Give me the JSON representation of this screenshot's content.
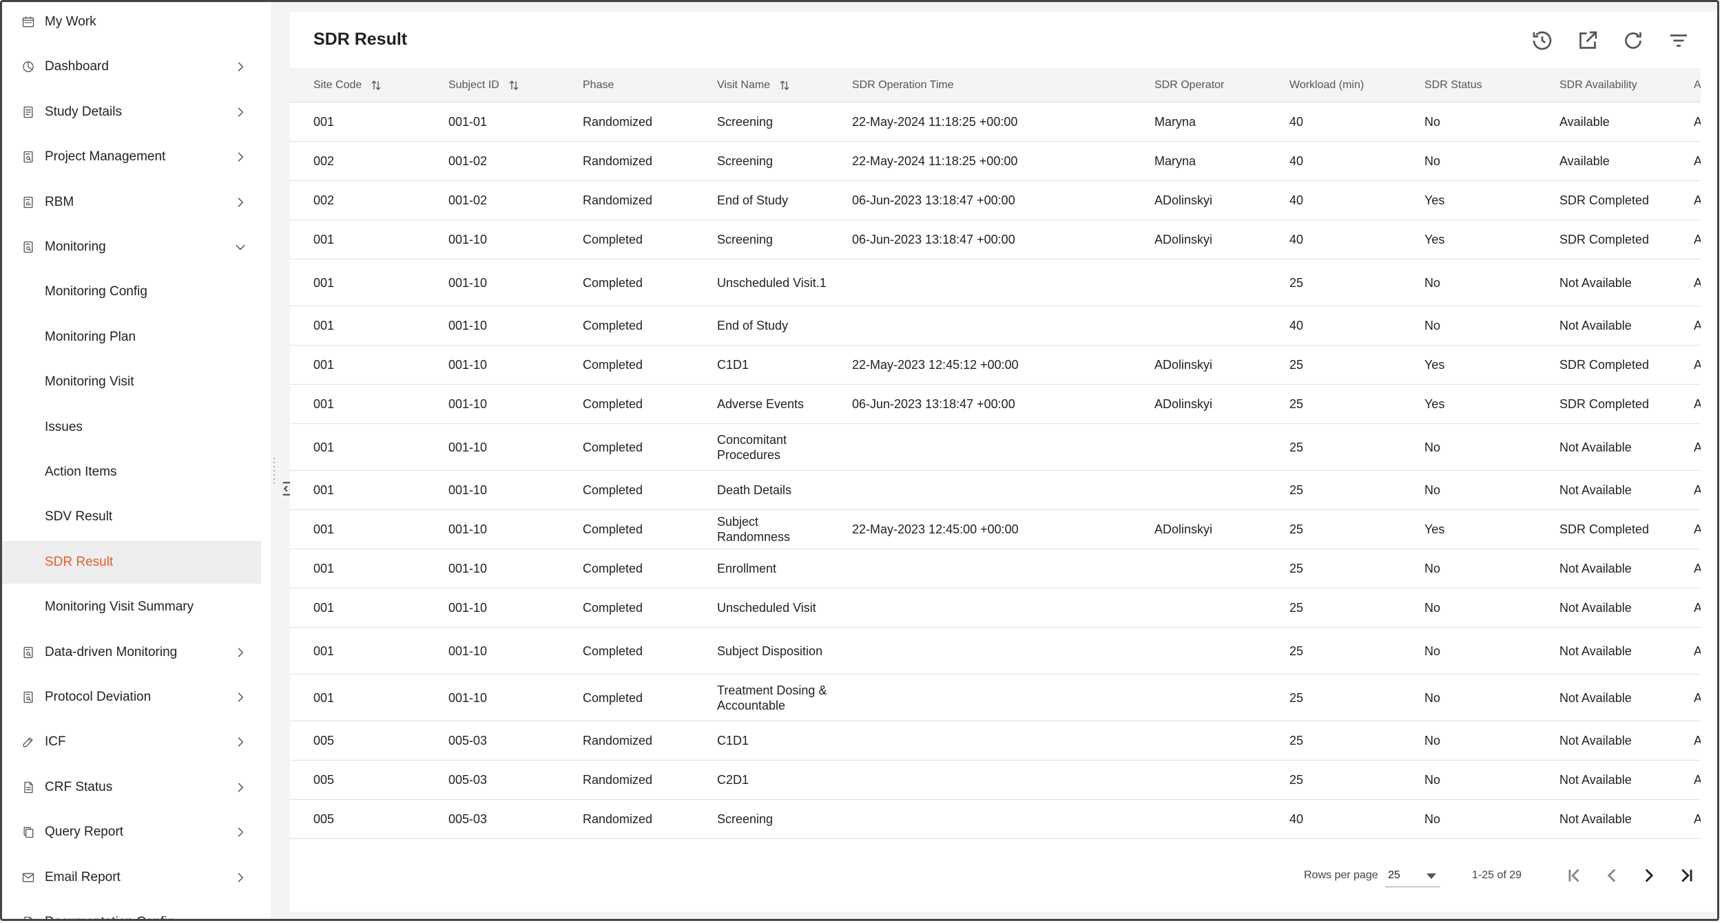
{
  "sidebar": {
    "items": [
      {
        "label": "My Work",
        "icon": "calendar-icon",
        "chevron": "none",
        "name": "my-work"
      },
      {
        "label": "Dashboard",
        "icon": "dashboard-icon",
        "chevron": "right",
        "name": "dashboard"
      },
      {
        "label": "Study Details",
        "icon": "document-icon",
        "chevron": "right",
        "name": "study-details"
      },
      {
        "label": "Project Management",
        "icon": "document-search-icon",
        "chevron": "right",
        "name": "project-management"
      },
      {
        "label": "RBM",
        "icon": "document-chart-icon",
        "chevron": "right",
        "name": "rbm"
      },
      {
        "label": "Monitoring",
        "icon": "document-search-icon",
        "chevron": "down",
        "name": "monitoring"
      },
      {
        "label": "Monitoring Config",
        "sub": true,
        "name": "monitoring-config"
      },
      {
        "label": "Monitoring Plan",
        "sub": true,
        "name": "monitoring-plan"
      },
      {
        "label": "Monitoring Visit",
        "sub": true,
        "name": "monitoring-visit"
      },
      {
        "label": "Issues",
        "sub": true,
        "name": "issues"
      },
      {
        "label": "Action Items",
        "sub": true,
        "name": "action-items"
      },
      {
        "label": "SDV Result",
        "sub": true,
        "name": "sdv-result"
      },
      {
        "label": "SDR Result",
        "sub": true,
        "active": true,
        "name": "sdr-result"
      },
      {
        "label": "Monitoring Visit Summary",
        "sub": true,
        "name": "monitoring-visit-summary"
      },
      {
        "label": "Data-driven Monitoring",
        "icon": "document-search-icon",
        "chevron": "right",
        "name": "data-driven-monitoring"
      },
      {
        "label": "Protocol Deviation",
        "icon": "document-search-icon",
        "chevron": "right",
        "name": "protocol-deviation"
      },
      {
        "label": "ICF",
        "icon": "edit-icon",
        "chevron": "right",
        "name": "icf"
      },
      {
        "label": "CRF Status",
        "icon": "file-icon",
        "chevron": "right",
        "name": "crf-status"
      },
      {
        "label": "Query Report",
        "icon": "copy-icon",
        "chevron": "right",
        "name": "query-report"
      },
      {
        "label": "Email Report",
        "icon": "mail-icon",
        "chevron": "right",
        "name": "email-report"
      },
      {
        "label": "Documentation Config",
        "icon": "file-icon",
        "chevron": "none",
        "name": "documentation-config"
      }
    ]
  },
  "page": {
    "title": "SDR Result",
    "tools": [
      "history-icon",
      "export-icon",
      "refresh-icon",
      "filter-icon"
    ]
  },
  "table": {
    "columns": [
      {
        "label": "Site Code",
        "sortable": true
      },
      {
        "label": "Subject ID",
        "sortable": true
      },
      {
        "label": "Phase",
        "sortable": false
      },
      {
        "label": "Visit Name",
        "sortable": true
      },
      {
        "label": "SDR Operation Time",
        "sortable": false
      },
      {
        "label": "SDR Operator",
        "sortable": false
      },
      {
        "label": "Workload (min)",
        "sortable": false
      },
      {
        "label": "SDR Status",
        "sortable": false
      },
      {
        "label": "SDR Availability",
        "sortable": false
      },
      {
        "label": "A",
        "sortable": false
      }
    ],
    "rows": [
      [
        "001",
        "001-01",
        "Randomized",
        "Screening",
        "22-May-2024 11:18:25 +00:00",
        "Maryna",
        "40",
        "No",
        "Available",
        "A"
      ],
      [
        "002",
        "001-02",
        "Randomized",
        "Screening",
        "22-May-2024 11:18:25 +00:00",
        "Maryna",
        "40",
        "No",
        "Available",
        "A"
      ],
      [
        "002",
        "001-02",
        "Randomized",
        "End of Study",
        "06-Jun-2023 13:18:47 +00:00",
        "ADolinskyi",
        "40",
        "Yes",
        "SDR Completed",
        "A"
      ],
      [
        "001",
        "001-10",
        "Completed",
        "Screening",
        "06-Jun-2023 13:18:47 +00:00",
        "ADolinskyi",
        "40",
        "Yes",
        "SDR Completed",
        "A"
      ],
      [
        "001",
        "001-10",
        "Completed",
        "Unscheduled Visit.1",
        "",
        "",
        "25",
        "No",
        "Not Available",
        "A"
      ],
      [
        "001",
        "001-10",
        "Completed",
        "End of Study",
        "",
        "",
        "40",
        "No",
        "Not Available",
        "A"
      ],
      [
        "001",
        "001-10",
        "Completed",
        "C1D1",
        "22-May-2023 12:45:12 +00:00",
        "ADolinskyi",
        "25",
        "Yes",
        "SDR Completed",
        "A"
      ],
      [
        "001",
        "001-10",
        "Completed",
        "Adverse Events",
        "06-Jun-2023 13:18:47 +00:00",
        "ADolinskyi",
        "25",
        "Yes",
        "SDR Completed",
        "A"
      ],
      [
        "001",
        "001-10",
        "Completed",
        "Concomitant Procedures",
        "",
        "",
        "25",
        "No",
        "Not Available",
        "A"
      ],
      [
        "001",
        "001-10",
        "Completed",
        "Death Details",
        "",
        "",
        "25",
        "No",
        "Not Available",
        "A"
      ],
      [
        "001",
        "001-10",
        "Completed",
        "Subject Randomness",
        "22-May-2023 12:45:00 +00:00",
        "ADolinskyi",
        "25",
        "Yes",
        "SDR Completed",
        "A"
      ],
      [
        "001",
        "001-10",
        "Completed",
        "Enrollment",
        "",
        "",
        "25",
        "No",
        "Not Available",
        "A"
      ],
      [
        "001",
        "001-10",
        "Completed",
        "Unscheduled Visit",
        "",
        "",
        "25",
        "No",
        "Not Available",
        "A"
      ],
      [
        "001",
        "001-10",
        "Completed",
        "Subject Disposition",
        "",
        "",
        "25",
        "No",
        "Not Available",
        "A"
      ],
      [
        "001",
        "001-10",
        "Completed",
        "Treatment Dosing & Accountable",
        "",
        "",
        "25",
        "No",
        "Not Available",
        "A"
      ],
      [
        "005",
        "005-03",
        "Randomized",
        "C1D1",
        "",
        "",
        "25",
        "No",
        "Not Available",
        "A"
      ],
      [
        "005",
        "005-03",
        "Randomized",
        "C2D1",
        "",
        "",
        "25",
        "No",
        "Not Available",
        "A"
      ],
      [
        "005",
        "005-03",
        "Randomized",
        "Screening",
        "",
        "",
        "40",
        "No",
        "Not Available",
        "A"
      ]
    ]
  },
  "pagination": {
    "rows_per_page_label": "Rows per page",
    "rows_per_page": "25",
    "range": "1-25 of 29"
  },
  "colors": {
    "accent": "#f05a28",
    "active_bg": "#eeeeee",
    "header_bg": "#f4f4f4"
  }
}
